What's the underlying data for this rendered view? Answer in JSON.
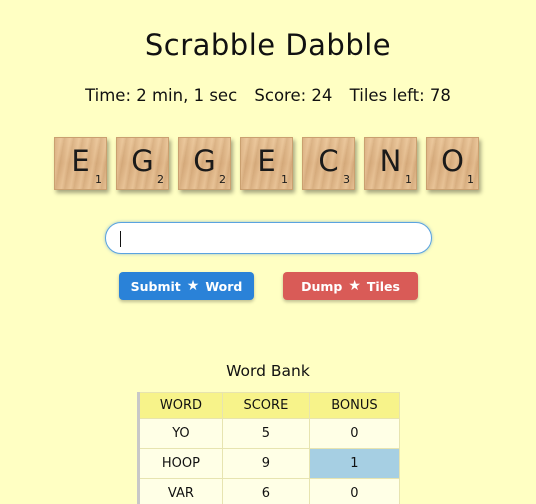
{
  "title": "Scrabble Dabble",
  "stats": {
    "time": "Time: 2 min, 1 sec",
    "score": "Score: 24",
    "tiles_left": "Tiles left: 78"
  },
  "tiles": [
    {
      "letter": "E",
      "points": "1"
    },
    {
      "letter": "G",
      "points": "2"
    },
    {
      "letter": "G",
      "points": "2"
    },
    {
      "letter": "E",
      "points": "1"
    },
    {
      "letter": "C",
      "points": "3"
    },
    {
      "letter": "N",
      "points": "1"
    },
    {
      "letter": "O",
      "points": "1"
    }
  ],
  "input": {
    "value": "",
    "placeholder": ""
  },
  "buttons": {
    "submit_left": "Submit",
    "submit_right": "Word",
    "dump_left": "Dump",
    "dump_right": "Tiles",
    "submit_color": "#2a82d8",
    "dump_color": "#d95b57"
  },
  "word_bank": {
    "title": "Word Bank",
    "headers": [
      "WORD",
      "SCORE",
      "BONUS"
    ],
    "rows": [
      [
        "YO",
        "5",
        "0"
      ],
      [
        "HOOP",
        "9",
        "1"
      ],
      [
        "VAR",
        "6",
        "0"
      ]
    ]
  },
  "icons": {
    "button_star": "star-icon"
  }
}
